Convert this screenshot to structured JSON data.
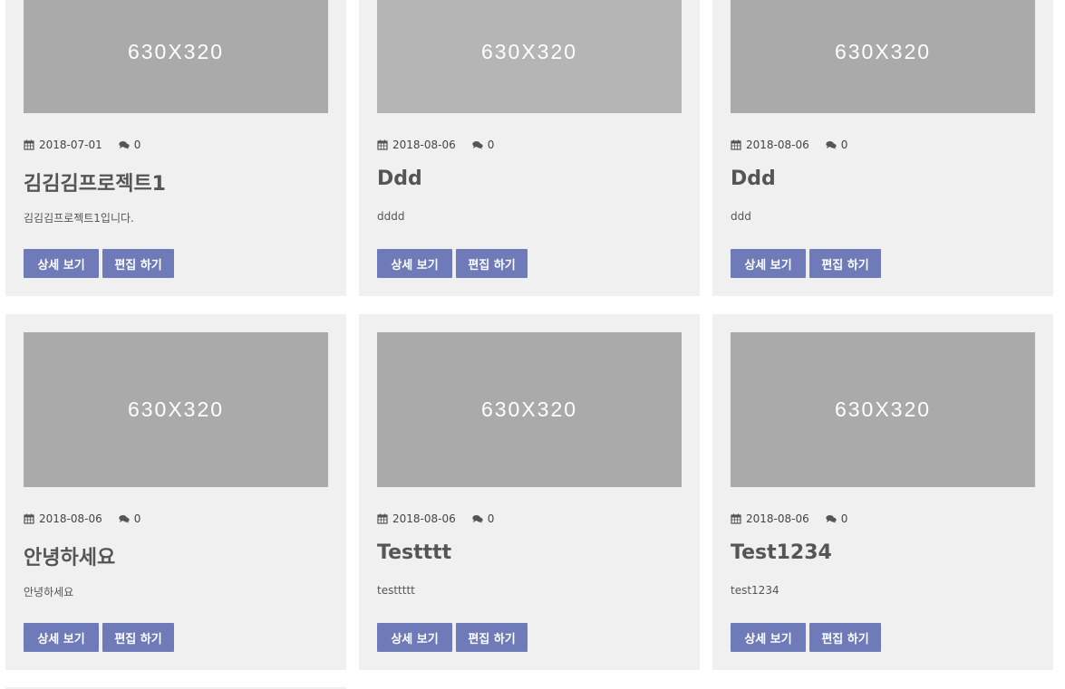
{
  "placeholder_label": "630X320",
  "button_view_label": "상세 보기",
  "button_edit_label": "편집 하기",
  "accent_color": "#6f7ab8",
  "card_background": "#f0f0f0",
  "thumb_color": "#aaaaaa",
  "icons": {
    "date": "calendar-icon",
    "comments": "comments-icon"
  },
  "projects": [
    {
      "date": "2018-07-01",
      "comments": "0",
      "title": "김김김프로젝트1",
      "description": "김김김프로젝트1입니다."
    },
    {
      "date": "2018-08-06",
      "comments": "0",
      "title": "Ddd",
      "description": "dddd"
    },
    {
      "date": "2018-08-06",
      "comments": "0",
      "title": "Ddd",
      "description": "ddd"
    },
    {
      "date": "2018-08-06",
      "comments": "0",
      "title": "안녕하세요",
      "description": "안녕하세요"
    },
    {
      "date": "2018-08-06",
      "comments": "0",
      "title": "Testttt",
      "description": "testtttt"
    },
    {
      "date": "2018-08-06",
      "comments": "0",
      "title": "Test1234",
      "description": "test1234"
    }
  ]
}
